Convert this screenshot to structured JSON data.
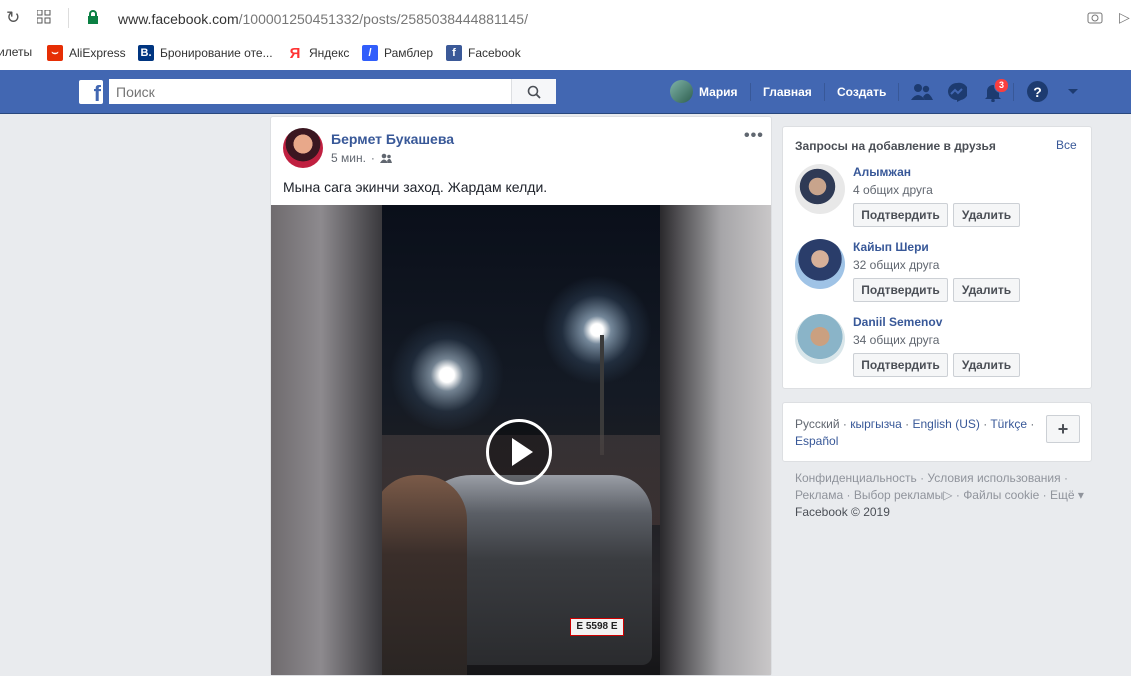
{
  "browser": {
    "url_host": "www.facebook.com",
    "url_path": "/100001250451332/posts/2585038444881145/",
    "bookmarks": [
      {
        "label": "илеты"
      },
      {
        "label": "AliExpress"
      },
      {
        "label": "Бронирование оте..."
      },
      {
        "label": "Яндекс"
      },
      {
        "label": "Рамблер"
      },
      {
        "label": "Facebook"
      }
    ]
  },
  "topbar": {
    "logo": "f",
    "search_placeholder": "Поиск",
    "user_name": "Мария",
    "home": "Главная",
    "create": "Создать",
    "notif_count": "3",
    "colors": {
      "bar": "#4267b2",
      "badge": "#fa3e3e"
    }
  },
  "post": {
    "author": "Бермет Букашева",
    "time": "5 мин.",
    "separator": "·",
    "text": "Мына сага экинчи заход. Жардам келди.",
    "video_plate": "E 5598 E"
  },
  "friend_requests": {
    "title": "Запросы на добавление в друзья",
    "all": "Все",
    "confirm": "Подтвердить",
    "delete": "Удалить",
    "items": [
      {
        "name": "Алымжан",
        "mutual": "4 общих друга"
      },
      {
        "name": "Кайып Шери",
        "mutual": "32 общих друга"
      },
      {
        "name": "Daniil Semenov",
        "mutual": "34 общих друга"
      }
    ]
  },
  "languages": {
    "current": "Русский",
    "items": [
      "кыргызча",
      "English (US)",
      "Türkçe",
      "Español"
    ],
    "add": "+"
  },
  "footer": {
    "links": [
      "Конфиденциальность",
      "Условия использования",
      "Реклама",
      "Выбор рекламы",
      "Файлы cookie",
      "Ещё"
    ],
    "copyright": "Facebook © 2019"
  }
}
